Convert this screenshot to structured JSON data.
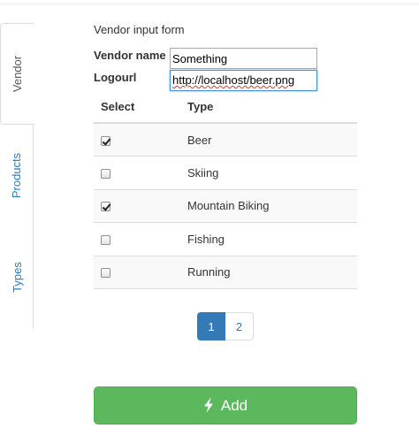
{
  "tabs": [
    {
      "label": "Vendor",
      "active": true
    },
    {
      "label": "Products",
      "active": false
    },
    {
      "label": "Types",
      "active": false
    }
  ],
  "form": {
    "title": "Vendor input form",
    "vendor_name_label": "Vendor name",
    "vendor_name_value": "Something",
    "logourl_label": "Logourl",
    "logourl_value": "http://localhost/beer.png"
  },
  "table": {
    "headers": [
      "Select",
      "Type"
    ],
    "rows": [
      {
        "checked": true,
        "type": "Beer"
      },
      {
        "checked": false,
        "type": "Skiing"
      },
      {
        "checked": true,
        "type": "Mountain Biking"
      },
      {
        "checked": false,
        "type": "Fishing"
      },
      {
        "checked": false,
        "type": "Running"
      }
    ]
  },
  "pagination": {
    "pages": [
      "1",
      "2"
    ],
    "current": "1"
  },
  "add_button": {
    "label": "Add",
    "icon": "bolt-icon"
  },
  "colors": {
    "accent": "#337ab7",
    "success": "#5cb85c"
  }
}
